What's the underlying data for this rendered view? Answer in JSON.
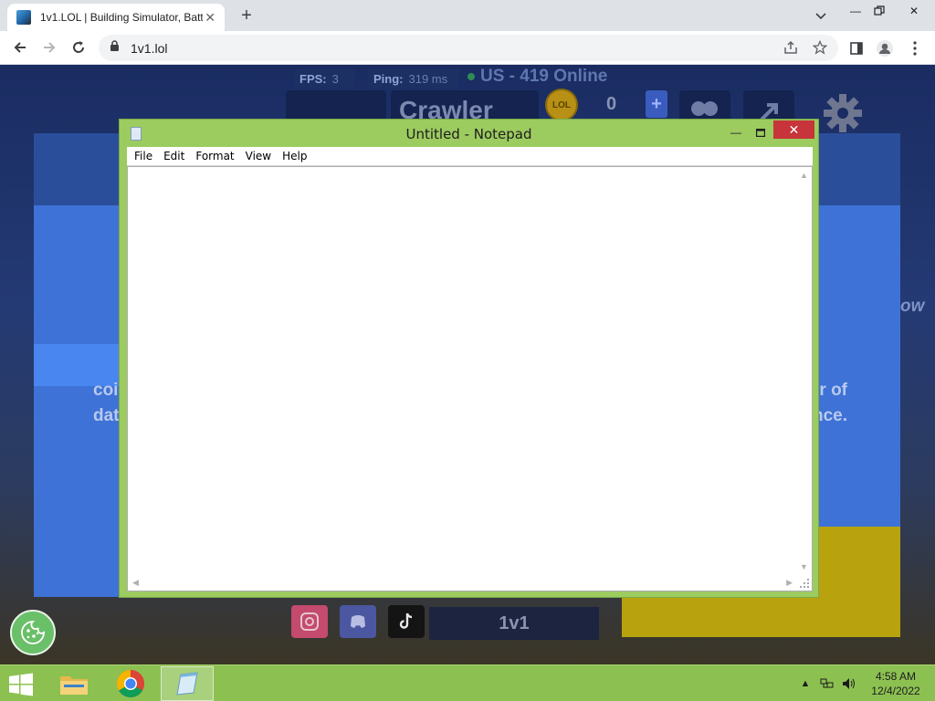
{
  "browser": {
    "tab_title": "1v1.LOL | Building Simulator, Batt",
    "url": "1v1.lol",
    "icons": [
      "back-icon",
      "forward-icon",
      "reload-icon",
      "lock-icon",
      "share-icon",
      "star-icon",
      "side-panel-icon",
      "profile-icon",
      "menu-icon"
    ]
  },
  "game": {
    "fps_label": "FPS:",
    "fps_value": "3",
    "ping_label": "Ping:",
    "ping_value": "319 ms",
    "online": "US - 419 Online",
    "player_name": "Crawler",
    "coin_label": "LOL",
    "coin_value": "0",
    "plus": "+",
    "modal_left_line1": "coi",
    "modal_left_line2": "dat",
    "modal_right_line1": "r of",
    "modal_right_line2": "nce.",
    "side_text": "ow",
    "social_label": "1v1"
  },
  "notepad": {
    "title": "Untitled - Notepad",
    "menu": [
      "File",
      "Edit",
      "Format",
      "View",
      "Help"
    ],
    "content": ""
  },
  "taskbar": {
    "time": "4:58 AM",
    "date": "12/4/2022",
    "apps": [
      "file-explorer",
      "chrome",
      "notepad"
    ],
    "active_app": "notepad"
  }
}
